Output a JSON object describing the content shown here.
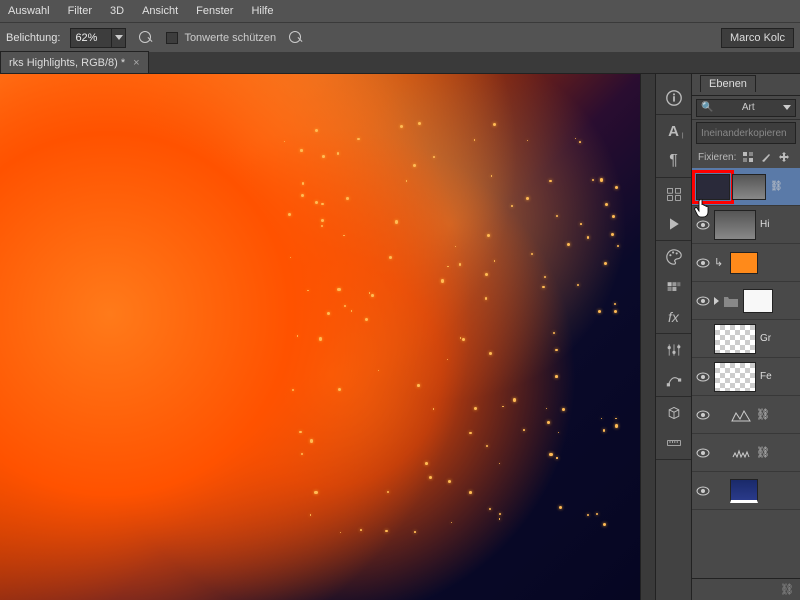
{
  "menu": {
    "items": [
      "Auswahl",
      "Filter",
      "3D",
      "Ansicht",
      "Fenster",
      "Hilfe"
    ]
  },
  "options": {
    "label_exposure": "Belichtung:",
    "exposure_value": "62%",
    "protect_tones_label": "Tonwerte schützen",
    "user_button": "Marco Kolc"
  },
  "tab": {
    "title": "rks Highlights, RGB/8) *"
  },
  "layers_panel": {
    "title": "Ebenen",
    "kind_label": "Art",
    "blend_mode": "Ineinanderkopieren",
    "lock_label": "Fixieren:"
  },
  "layers": [
    {
      "name": "",
      "visible": true,
      "selected": true,
      "thumb": "fire",
      "has_mask": true
    },
    {
      "name": "Hi",
      "visible": true,
      "thumb": "fire"
    },
    {
      "name": "",
      "visible": true,
      "thumb": "orange",
      "clipped": true
    },
    {
      "name": "",
      "visible": true,
      "thumb": "white",
      "group": true
    },
    {
      "name": "Gr",
      "visible": false,
      "thumb": "checker"
    },
    {
      "name": "Fe",
      "visible": true,
      "thumb": "checker"
    },
    {
      "name": "",
      "visible": true,
      "adjustment": "levels"
    },
    {
      "name": "",
      "visible": true,
      "adjustment": "crown"
    },
    {
      "name": "",
      "visible": true,
      "thumb": "blue"
    }
  ]
}
